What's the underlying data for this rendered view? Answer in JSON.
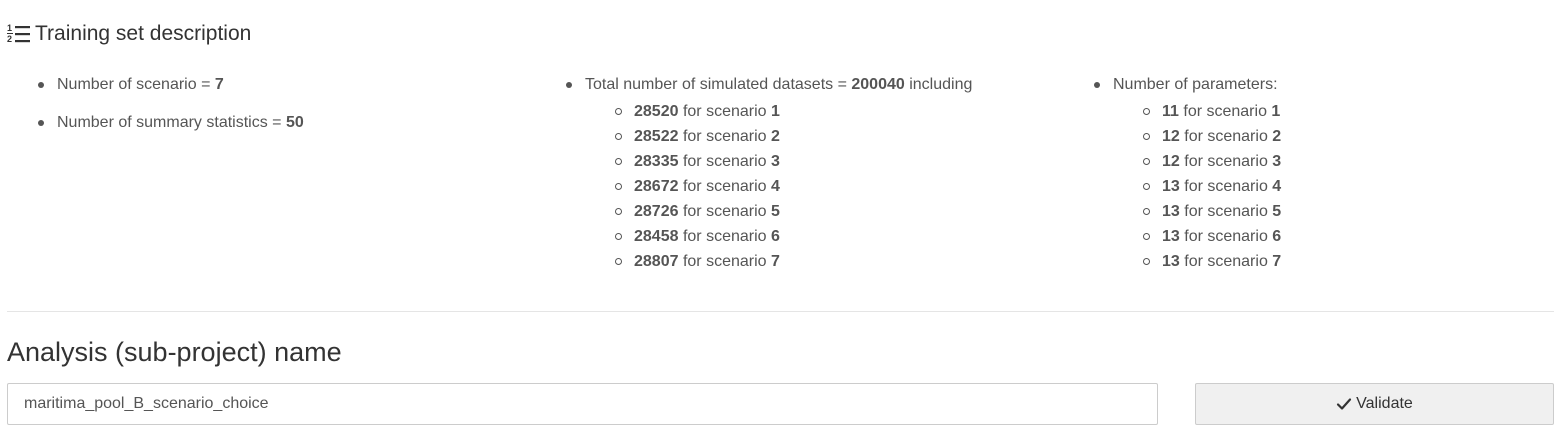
{
  "training_set": {
    "title": "Training set description",
    "icon": "ordered-list-icon",
    "scenario_count": {
      "label": "Number of scenario = ",
      "value": "7"
    },
    "summary_stats": {
      "label": "Number of summary statistics = ",
      "value": "50"
    },
    "datasets": {
      "label_prefix": "Total number of simulated datasets = ",
      "total": "200040",
      "label_suffix": " including",
      "items": [
        {
          "count": "28520",
          "text": " for scenario ",
          "scenario": "1"
        },
        {
          "count": "28522",
          "text": " for scenario ",
          "scenario": "2"
        },
        {
          "count": "28335",
          "text": " for scenario ",
          "scenario": "3"
        },
        {
          "count": "28672",
          "text": " for scenario ",
          "scenario": "4"
        },
        {
          "count": "28726",
          "text": " for scenario ",
          "scenario": "5"
        },
        {
          "count": "28458",
          "text": " for scenario ",
          "scenario": "6"
        },
        {
          "count": "28807",
          "text": " for scenario ",
          "scenario": "7"
        }
      ]
    },
    "parameters": {
      "label": "Number of parameters:",
      "items": [
        {
          "count": "11",
          "text": " for scenario ",
          "scenario": "1"
        },
        {
          "count": "12",
          "text": " for scenario ",
          "scenario": "2"
        },
        {
          "count": "12",
          "text": " for scenario ",
          "scenario": "3"
        },
        {
          "count": "13",
          "text": " for scenario ",
          "scenario": "4"
        },
        {
          "count": "13",
          "text": " for scenario ",
          "scenario": "5"
        },
        {
          "count": "13",
          "text": " for scenario ",
          "scenario": "6"
        },
        {
          "count": "13",
          "text": " for scenario ",
          "scenario": "7"
        }
      ]
    }
  },
  "analysis": {
    "title": "Analysis (sub-project) name",
    "input_value": "maritima_pool_B_scenario_choice",
    "validate_label": "Validate",
    "validate_icon": "check-icon"
  }
}
